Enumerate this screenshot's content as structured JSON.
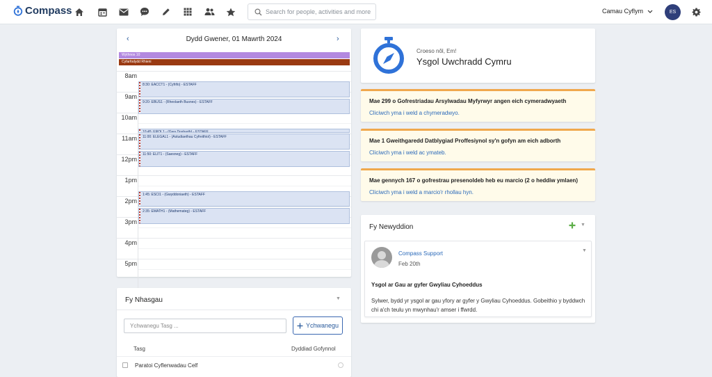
{
  "app": {
    "name": "Compass"
  },
  "search": {
    "placeholder": "Search for people, activities and more..."
  },
  "header": {
    "school_selector": "Camau Cyflym",
    "avatar_initials": "ES"
  },
  "nav_icons": [
    "home-icon",
    "calendar-icon",
    "mail-icon",
    "chat-icon",
    "pencil-icon",
    "grid-icon",
    "people-icon",
    "star-icon"
  ],
  "calendar": {
    "date_title": "Dydd Gwener, 01 Mawrth 2024",
    "all_day": [
      {
        "label": "Wythnos 10",
        "color": "#b389e0"
      },
      {
        "label": "Cyfarfodydd Rhieni",
        "color": "#9a3a12"
      }
    ],
    "hours": [
      "8am",
      "9am",
      "10am",
      "11am",
      "12pm",
      "1pm",
      "2pm",
      "3pm",
      "4pm",
      "5pm"
    ],
    "events": [
      {
        "label": "8:30: EACCT1 - (Cyfrifo) - ESTAFF",
        "start": 8.5,
        "end": 9.25
      },
      {
        "label": "9:20: EBUS1 - (Rheolaeth Busnes) - ESTAFF",
        "start": 9.33,
        "end": 10.08
      },
      {
        "label": "10:45: EROL1 - (Gwa Dosbarth) - ESTAFF",
        "start": 10.75,
        "end": 10.97
      },
      {
        "label": "11:00: ELEGAL1 - (Astudiaethau Cyfreithiol) - ESTAFF",
        "start": 11.0,
        "end": 11.75
      },
      {
        "label": "11:50: ELIT1 - (Saesneg) - ESTAFF",
        "start": 11.83,
        "end": 12.6
      },
      {
        "label": "1:45: ESCI1 - (Gwyddoniaeth) - ESTAFF",
        "start": 13.75,
        "end": 14.5
      },
      {
        "label": "2:35: EMATH1 - (Mathemateg) - ESTAFF",
        "start": 14.58,
        "end": 15.33
      }
    ]
  },
  "tasks": {
    "title": "Fy Nhasgau",
    "input_placeholder": "Ychwanegu Tasg ...",
    "add_button": "Ychwanegu",
    "col_task": "Tasg",
    "col_due": "Dyddiad Gofynnol",
    "items": [
      {
        "label": "Paratoi Cyflenwadau Celf"
      }
    ]
  },
  "welcome": {
    "greeting": "Croeso nôl, Em!",
    "school": "Ysgol Uwchradd Cymru"
  },
  "notices": [
    {
      "title": "Mae 299 o Gofrestriadau Arsylwadau Myfyrwyr angen eich cymeradwyaeth",
      "link": "Cliciwch yma i weld a chymeradwyo."
    },
    {
      "title": "Mae 1 Gweithgaredd Datblygiad Proffesiynol sy'n gofyn am eich adborth",
      "link": "Cliciwch yma i weld ac ymateb."
    },
    {
      "title": "Mae gennych 167 o gofrestrau presenoldeb heb eu marcio (2 o heddiw ymlaen)",
      "link": "Cliciwch yma i weld a marcio'r rhollau hyn."
    }
  ],
  "news": {
    "title": "Fy Newyddion",
    "item": {
      "author": "Compass Support",
      "date": "Feb 20th",
      "headline": "Ysgol ar Gau ar gyfer Gwyliau Cyhoeddus",
      "body": "Sylwer, bydd yr ysgol ar gau yfory ar gyfer y Gwyliau Cyhoeddus. Gobeithio y byddwch chi a'ch teulu yn mwynhau'r amser i ffwrdd."
    }
  },
  "colors": {
    "brand": "#2f72d8",
    "link": "#2a69b9",
    "notice_border": "#f0a84d",
    "add_green": "#5cae47"
  }
}
